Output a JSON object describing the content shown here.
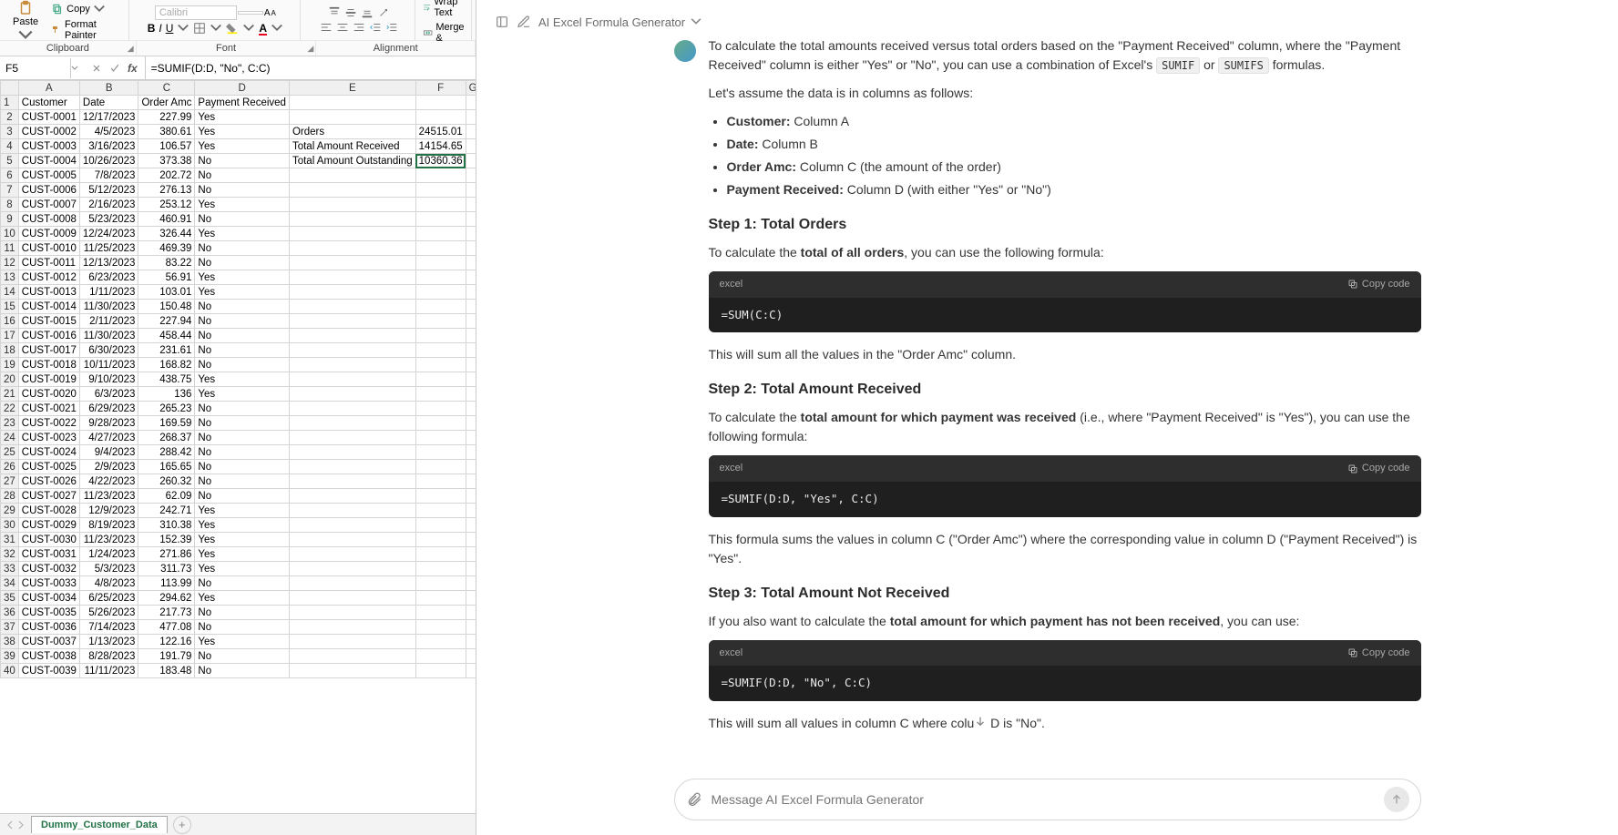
{
  "ribbon": {
    "paste": "Paste",
    "copy": "Copy",
    "format_painter": "Format Painter",
    "wrap_text": "Wrap Text",
    "merge": "Merge &",
    "groups": {
      "clipboard": "Clipboard",
      "font": "Font",
      "alignment": "Alignment"
    },
    "font_name": "Calibri"
  },
  "formula_bar": {
    "cell_ref": "F5",
    "formula": "=SUMIF(D:D, \"No\", C:C)"
  },
  "columns": [
    "A",
    "B",
    "C",
    "D",
    "E",
    "F",
    "G"
  ],
  "headers": {
    "a": "Customer",
    "b": "Date",
    "c": "Order Amc",
    "d": "Payment Received"
  },
  "summary": {
    "orders_label": "Orders",
    "orders_val": "24515.01",
    "received_label": "Total Amount Received",
    "received_val": "14154.65",
    "outstanding_label": "Total Amount Outstanding",
    "outstanding_val": "10360.36"
  },
  "rows": [
    {
      "r": 2,
      "a": "CUST-0001",
      "b": "12/17/2023",
      "c": "227.99",
      "d": "Yes"
    },
    {
      "r": 3,
      "a": "CUST-0002",
      "b": "4/5/2023",
      "c": "380.61",
      "d": "Yes"
    },
    {
      "r": 4,
      "a": "CUST-0003",
      "b": "3/16/2023",
      "c": "106.57",
      "d": "Yes"
    },
    {
      "r": 5,
      "a": "CUST-0004",
      "b": "10/26/2023",
      "c": "373.38",
      "d": "No"
    },
    {
      "r": 6,
      "a": "CUST-0005",
      "b": "7/8/2023",
      "c": "202.72",
      "d": "No"
    },
    {
      "r": 7,
      "a": "CUST-0006",
      "b": "5/12/2023",
      "c": "276.13",
      "d": "No"
    },
    {
      "r": 8,
      "a": "CUST-0007",
      "b": "2/16/2023",
      "c": "253.12",
      "d": "Yes"
    },
    {
      "r": 9,
      "a": "CUST-0008",
      "b": "5/23/2023",
      "c": "460.91",
      "d": "No"
    },
    {
      "r": 10,
      "a": "CUST-0009",
      "b": "12/24/2023",
      "c": "326.44",
      "d": "Yes"
    },
    {
      "r": 11,
      "a": "CUST-0010",
      "b": "11/25/2023",
      "c": "469.39",
      "d": "No"
    },
    {
      "r": 12,
      "a": "CUST-0011",
      "b": "12/13/2023",
      "c": "83.22",
      "d": "No"
    },
    {
      "r": 13,
      "a": "CUST-0012",
      "b": "6/23/2023",
      "c": "56.91",
      "d": "Yes"
    },
    {
      "r": 14,
      "a": "CUST-0013",
      "b": "1/11/2023",
      "c": "103.01",
      "d": "Yes"
    },
    {
      "r": 15,
      "a": "CUST-0014",
      "b": "11/30/2023",
      "c": "150.48",
      "d": "No"
    },
    {
      "r": 16,
      "a": "CUST-0015",
      "b": "2/11/2023",
      "c": "227.94",
      "d": "No"
    },
    {
      "r": 17,
      "a": "CUST-0016",
      "b": "11/30/2023",
      "c": "458.44",
      "d": "No"
    },
    {
      "r": 18,
      "a": "CUST-0017",
      "b": "6/30/2023",
      "c": "231.61",
      "d": "No"
    },
    {
      "r": 19,
      "a": "CUST-0018",
      "b": "10/11/2023",
      "c": "168.82",
      "d": "No"
    },
    {
      "r": 20,
      "a": "CUST-0019",
      "b": "9/10/2023",
      "c": "438.75",
      "d": "Yes"
    },
    {
      "r": 21,
      "a": "CUST-0020",
      "b": "6/3/2023",
      "c": "136",
      "d": "Yes"
    },
    {
      "r": 22,
      "a": "CUST-0021",
      "b": "6/29/2023",
      "c": "265.23",
      "d": "No"
    },
    {
      "r": 23,
      "a": "CUST-0022",
      "b": "9/28/2023",
      "c": "169.59",
      "d": "No"
    },
    {
      "r": 24,
      "a": "CUST-0023",
      "b": "4/27/2023",
      "c": "268.37",
      "d": "No"
    },
    {
      "r": 25,
      "a": "CUST-0024",
      "b": "9/4/2023",
      "c": "288.42",
      "d": "No"
    },
    {
      "r": 26,
      "a": "CUST-0025",
      "b": "2/9/2023",
      "c": "165.65",
      "d": "No"
    },
    {
      "r": 27,
      "a": "CUST-0026",
      "b": "4/22/2023",
      "c": "260.32",
      "d": "No"
    },
    {
      "r": 28,
      "a": "CUST-0027",
      "b": "11/23/2023",
      "c": "62.09",
      "d": "No"
    },
    {
      "r": 29,
      "a": "CUST-0028",
      "b": "12/9/2023",
      "c": "242.71",
      "d": "Yes"
    },
    {
      "r": 30,
      "a": "CUST-0029",
      "b": "8/19/2023",
      "c": "310.38",
      "d": "Yes"
    },
    {
      "r": 31,
      "a": "CUST-0030",
      "b": "11/23/2023",
      "c": "152.39",
      "d": "Yes"
    },
    {
      "r": 32,
      "a": "CUST-0031",
      "b": "1/24/2023",
      "c": "271.86",
      "d": "Yes"
    },
    {
      "r": 33,
      "a": "CUST-0032",
      "b": "5/3/2023",
      "c": "311.73",
      "d": "Yes"
    },
    {
      "r": 34,
      "a": "CUST-0033",
      "b": "4/8/2023",
      "c": "113.99",
      "d": "No"
    },
    {
      "r": 35,
      "a": "CUST-0034",
      "b": "6/25/2023",
      "c": "294.62",
      "d": "Yes"
    },
    {
      "r": 36,
      "a": "CUST-0035",
      "b": "5/26/2023",
      "c": "217.73",
      "d": "No"
    },
    {
      "r": 37,
      "a": "CUST-0036",
      "b": "7/14/2023",
      "c": "477.08",
      "d": "No"
    },
    {
      "r": 38,
      "a": "CUST-0037",
      "b": "1/13/2023",
      "c": "122.16",
      "d": "Yes"
    },
    {
      "r": 39,
      "a": "CUST-0038",
      "b": "8/28/2023",
      "c": "191.79",
      "d": "No"
    },
    {
      "r": 40,
      "a": "CUST-0039",
      "b": "11/11/2023",
      "c": "183.48",
      "d": "No"
    }
  ],
  "sheet_tab": "Dummy_Customer_Data",
  "ai": {
    "title": "AI Excel Formula Generator",
    "intro_1": "To calculate the total amounts received versus total orders based on the \"Payment Received\" column, where the \"Payment Received\" column is either \"Yes\" or \"No\", you can use a combination of Excel's ",
    "code_sumif": "SUMIF",
    "or": " or ",
    "code_sumifs": "SUMIFS",
    "intro_2": " formulas.",
    "assume": "Let's assume the data is in columns as follows:",
    "li1b": "Customer:",
    "li1": " Column A",
    "li2b": "Date:",
    "li2": " Column B",
    "li3b": "Order Amc:",
    "li3": " Column C (the amount of the order)",
    "li4b": "Payment Received:",
    "li4": " Column D (with either \"Yes\" or \"No\")",
    "step1_h": "Step 1: Total Orders",
    "step1_p1": "To calculate the ",
    "step1_b": "total of all orders",
    "step1_p2": ", you can use the following formula:",
    "lang": "excel",
    "copy": "Copy code",
    "code1": "=SUM(C:C)",
    "step1_after": "This will sum all the values in the \"Order Amc\" column.",
    "step2_h": "Step 2: Total Amount Received",
    "step2_p1": "To calculate the ",
    "step2_b": "total amount for which payment was received",
    "step2_p2": " (i.e., where \"Payment Received\" is \"Yes\"), you can use the following formula:",
    "code2": "=SUMIF(D:D, \"Yes\", C:C)",
    "step2_after": "This formula sums the values in column C (\"Order Amc\") where the corresponding value in column D (\"Payment Received\") is \"Yes\".",
    "step3_h": "Step 3: Total Amount Not Received",
    "step3_p1": "If you also want to calculate the ",
    "step3_b": "total amount for which payment has not been received",
    "step3_p2": ", you can use:",
    "code3": "=SUMIF(D:D, \"No\", C:C)",
    "step3_after_1": "This will sum all values in column C where colu",
    "step3_after_2": " D is \"No\".",
    "placeholder": "Message AI Excel Formula Generator"
  }
}
